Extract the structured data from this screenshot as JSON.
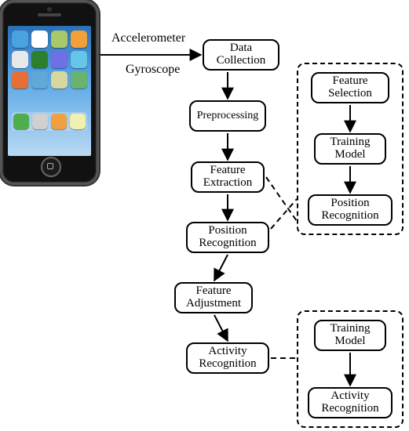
{
  "sensors": {
    "accelerometer_label": "Accelerometer",
    "gyroscope_label": "Gyroscope"
  },
  "main_flow": {
    "data_collection": "Data Collection",
    "preprocessing": "Preprocessing",
    "feature_extraction": "Feature Extraction",
    "position_recognition": "Position Recognition",
    "feature_adjustment": "Feature Adjustment",
    "activity_recognition": "Activity Recognition"
  },
  "position_module": {
    "feature_selection": "Feature Selection",
    "training_model": "Training Model",
    "position_recognition": "Position Recognition"
  },
  "activity_module": {
    "training_model": "Training Model",
    "activity_recognition": "Activity Recognition"
  },
  "phone_apps": [
    "#4aa2e0",
    "#ffffff",
    "#a7c96a",
    "#f2a13a",
    "#e8e8e8",
    "#2c7f2c",
    "#6f6fe6",
    "#66c6e8",
    "#e86f33",
    "#5fa8d8",
    "#d7d7a0",
    "#69b36f"
  ],
  "phone_dock": [
    "#4cae4c",
    "#d0d0d0",
    "#f0a040",
    "#f0f0b0"
  ]
}
